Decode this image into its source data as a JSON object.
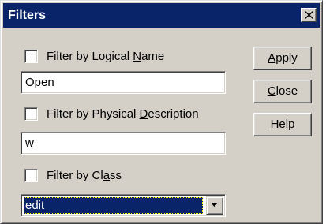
{
  "window": {
    "title": "Filters"
  },
  "filters": {
    "logical_name": {
      "label_pre": "Filter by Logical ",
      "label_accel": "N",
      "label_post": "ame",
      "checked": false,
      "value": "Open"
    },
    "physical_description": {
      "label_pre": "Filter by Physical ",
      "label_accel": "D",
      "label_post": "escription",
      "checked": false,
      "value": "w"
    },
    "class": {
      "label_pre": "Filter by Cl",
      "label_accel": "a",
      "label_post": "ss",
      "checked": false,
      "selected": "edit"
    }
  },
  "buttons": {
    "apply": {
      "accel": "A",
      "rest": "pply"
    },
    "close": {
      "accel": "C",
      "rest": "lose"
    },
    "help": {
      "accel": "H",
      "rest": "elp"
    }
  },
  "icons": {
    "close": "close-icon",
    "dropdown": "chevron-down-icon"
  },
  "colors": {
    "face": "#d4d0c8",
    "titlebar": "#0a246a",
    "selection": "#0a246a"
  }
}
